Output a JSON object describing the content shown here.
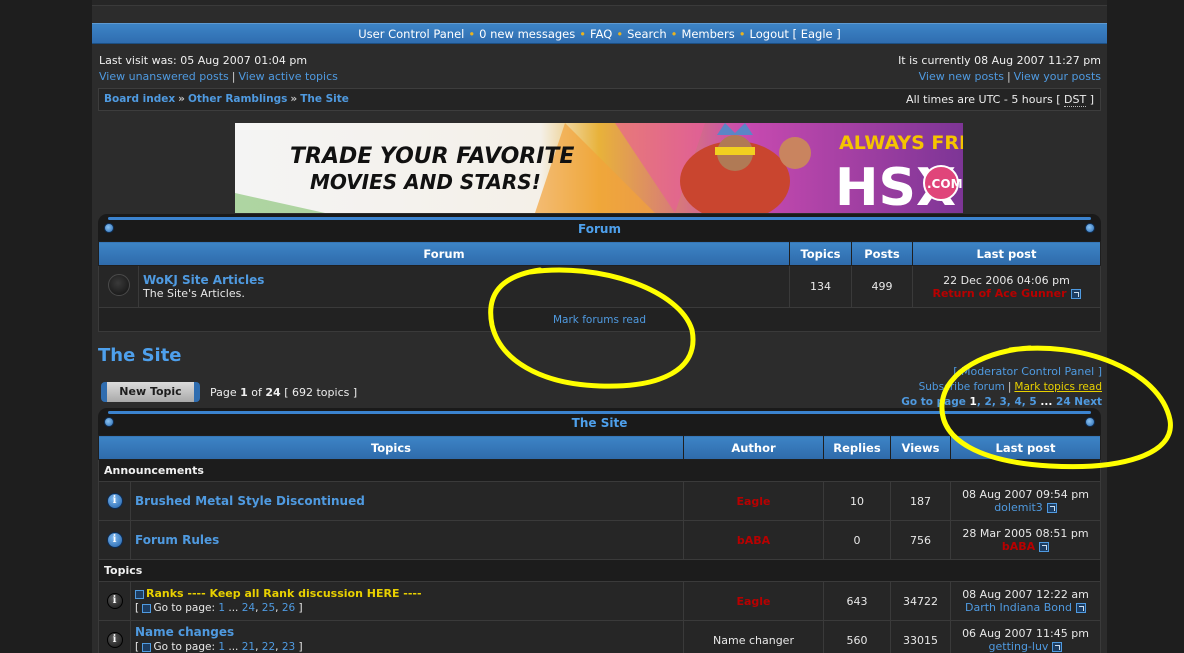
{
  "nav": {
    "links": [
      "User Control Panel",
      "0 new messages",
      "FAQ",
      "Search",
      "Members",
      "Logout [ Eagle ]"
    ]
  },
  "info": {
    "last_visit": "Last visit was: 05 Aug 2007 01:04 pm",
    "unanswered": "View unanswered posts",
    "active": "View active topics",
    "current_time": "It is currently 08 Aug 2007 11:27 pm",
    "new_posts": "View new posts",
    "your_posts": "View your posts"
  },
  "breadcrumb": {
    "items": [
      "Board index",
      "Other Ramblings",
      "The Site"
    ],
    "tz_prefix": "All times are UTC - 5 hours [",
    "tz_dst": "DST",
    "tz_suffix": "]"
  },
  "banner": {
    "line1": "TRADE YOUR FAVORITE",
    "line2": "MOVIES AND STARS!",
    "always_free": "ALWAYS FREE",
    "brand": "HSX",
    "com": ".COM"
  },
  "forum_block": {
    "title": "Forum",
    "headers": [
      "Forum",
      "Topics",
      "Posts",
      "Last post"
    ],
    "row": {
      "name": "WoKJ Site Articles",
      "desc": "The Site's Articles.",
      "topics": "134",
      "posts": "499",
      "last_date": "22 Dec 2006 04:06 pm",
      "last_user": "Return of Ace Gunner"
    },
    "mark_read": "Mark forums read"
  },
  "topic_area": {
    "title": "The Site",
    "new_topic": "New Topic",
    "page_prefix": "Page ",
    "page_current": "1",
    "page_of": " of ",
    "page_total": "24",
    "topic_count": "[ 692 topics ]",
    "mod_cp": "[ Moderator Control Panel ]",
    "subscribe": "Subscribe forum",
    "mark_topics": "Mark topics read",
    "goto_label": "Go to page",
    "goto_pages": [
      "1",
      "2",
      "3",
      "4",
      "5"
    ],
    "goto_ellipsis": "...",
    "goto_last": "24",
    "goto_next": "Next"
  },
  "topics_block": {
    "title": "The Site",
    "headers": [
      "Topics",
      "Author",
      "Replies",
      "Views",
      "Last post"
    ],
    "announcements_label": "Announcements",
    "topics_label": "Topics",
    "announcements": [
      {
        "title": "Brushed Metal Style Discontinued",
        "author": "Eagle",
        "replies": "10",
        "views": "187",
        "last_date": "08 Aug 2007 09:54 pm",
        "last_user": "dolemit3"
      },
      {
        "title": "Forum Rules",
        "author": "bABA",
        "replies": "0",
        "views": "756",
        "last_date": "28 Mar 2005 08:51 pm",
        "last_user": "bABA"
      }
    ],
    "topics": [
      {
        "title": "Ranks ---- Keep all Rank discussion HERE ----",
        "goto": "Go to page:",
        "pages": [
          "1",
          "...",
          "24",
          "25",
          "26"
        ],
        "author": "Eagle",
        "replies": "643",
        "views": "34722",
        "last_date": "08 Aug 2007 12:22 am",
        "last_user": "Darth Indiana Bond"
      },
      {
        "title": "Name changes",
        "goto": "Go to page:",
        "pages": [
          "1",
          "...",
          "21",
          "22",
          "23"
        ],
        "author": "Name changer",
        "replies": "560",
        "views": "33015",
        "last_date": "06 Aug 2007 11:45 pm",
        "last_user": "getting-luv"
      }
    ]
  },
  "colors": {
    "accent_blue": "#3d84c6",
    "link_blue": "#4f9ae0",
    "admin_red": "#b80000",
    "annotation_yellow": "#ffff00"
  }
}
